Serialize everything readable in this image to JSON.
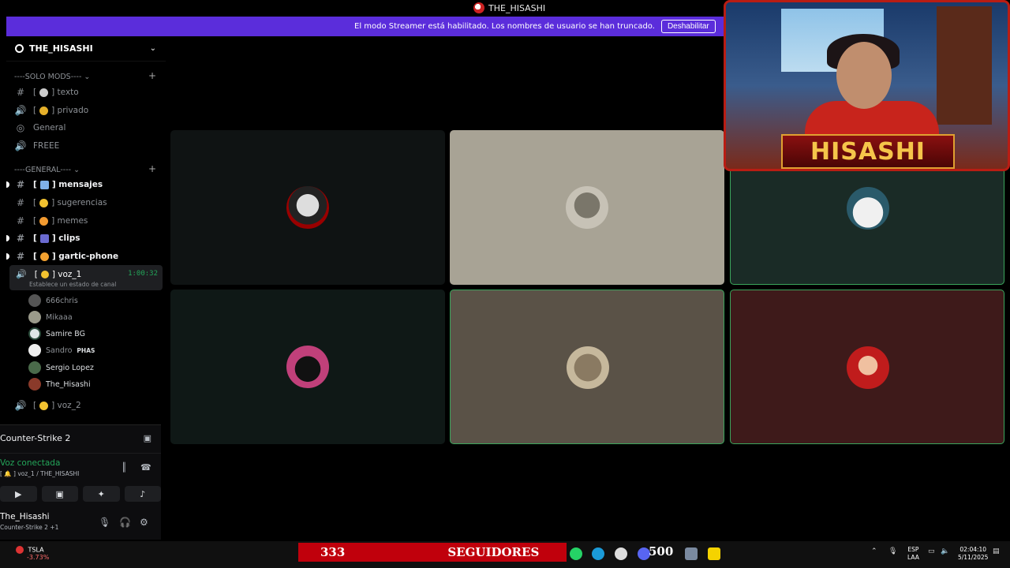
{
  "window": {
    "title": "THE_HISASHI"
  },
  "banner": {
    "message": "El modo Streamer está habilitado. Los nombres de usuario se han truncado.",
    "button": "Deshabilitar"
  },
  "server": {
    "name": "THE_HISASHI"
  },
  "categories": [
    {
      "label": "----SOLO MODS---- ⌄"
    },
    {
      "label": "----GENERAL---- ⌄"
    }
  ],
  "channels": [
    {
      "label": "texto",
      "icon": "#"
    },
    {
      "label": "privado",
      "icon": "🔊"
    },
    {
      "label": "General",
      "icon": "◎"
    },
    {
      "label": "FREEE",
      "icon": "🔊"
    },
    {
      "label": "mensajes",
      "icon": "#"
    },
    {
      "label": "sugerencias",
      "icon": "#"
    },
    {
      "label": "memes",
      "icon": "#"
    },
    {
      "label": "clips",
      "icon": "#"
    },
    {
      "label": "gartic-phone",
      "icon": "#"
    },
    {
      "label": "voz_2",
      "icon": "🔊"
    }
  ],
  "voice_channel": {
    "name": "voz_1",
    "timer": "1:00:32",
    "status": "Establece un estado de canal"
  },
  "voice_users": [
    {
      "name": "666chris"
    },
    {
      "name": "Mikaaa"
    },
    {
      "name": "Samire BG"
    },
    {
      "name": "Sandro",
      "tag": "PHAS"
    },
    {
      "name": "Sergio Lopez"
    },
    {
      "name": "The_Hisashi"
    }
  ],
  "panel": {
    "game": "Counter-Strike 2",
    "voice_connected": "Voz conectada",
    "voice_location": "[ 🔔 ] voz_1 / THE_HISASHI",
    "username": "The_Hisashi",
    "user_status": "Counter-Strike 2 +1"
  },
  "webcam": {
    "name_plate": "HISASHI"
  },
  "taskbar": {
    "stock_name": "TSLA",
    "stock_change": "-3.73%",
    "followers_count": "333",
    "followers_label": "SEGUIDORES",
    "badge_500": "500",
    "lang_1": "ESP",
    "lang_2": "LAA",
    "time": "02:04:10",
    "date": "5/11/2025"
  },
  "colors": {
    "banner": "#5b2ddb",
    "voice_green": "#23a559",
    "followers_red": "#c0000c"
  }
}
